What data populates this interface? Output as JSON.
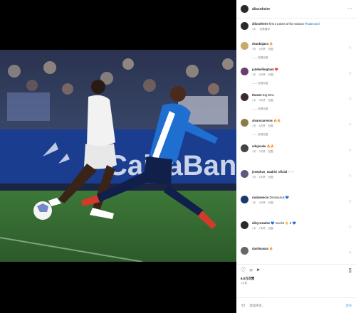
{
  "post": {
    "author": "dilsonfreire",
    "caption": "first 3 points of the season",
    "hashtag": "#hala­ma­rid",
    "caption_time": "1天",
    "caption_translate": "查看翻译"
  },
  "photo": {
    "banner_text": "CaixaBank",
    "dots": "• • •"
  },
  "comments": [
    {
      "user": "dsanbajaco",
      "text": "🔥",
      "time": "1天",
      "likes": "4次赞",
      "reply": "回复",
      "replies": "—— 查看回复",
      "color": "#c9a86b"
    },
    {
      "user": "judebellingham",
      "text": "❤️",
      "time": "1天",
      "likes": "6次赞",
      "reply": "回复",
      "replies": "—— 查看回复",
      "color": "#6a3d6e"
    },
    {
      "user": "thusen",
      "text": "Big Dino",
      "time": "1天",
      "likes": "3次赞",
      "reply": "回复",
      "replies": "—— 查看回复",
      "color": "#3d2a2a"
    },
    {
      "user": "alvarocarreras",
      "text": "🔥🔥",
      "time": "1天",
      "likes": "5次赞",
      "reply": "回复",
      "replies": "—— 查看回复",
      "color": "#8b7d4a"
    },
    {
      "user": "edujosele",
      "text": "🔥🔥",
      "time": "1天",
      "likes": "2次赞",
      "reply": "回复",
      "replies": "",
      "color": "#444"
    },
    {
      "user": "josephus_madrid_oficial",
      "text": "♡ ♡",
      "time": "1天",
      "likes": "1次赞",
      "reply": "回复",
      "replies": "",
      "color": "#5a5a7a"
    },
    {
      "user": "raulasencio",
      "text": "Dinosaurus 💙",
      "time": "1天",
      "likes": "4次赞",
      "reply": "回复",
      "replies": "",
      "color": "#1a3a6a"
    },
    {
      "user": "alleyrozadee",
      "text": "💙 mucho 👋 ♥ 💙",
      "time": "1天",
      "likes": "2次赞",
      "reply": "回复",
      "replies": "",
      "color": "#2a2a2a"
    },
    {
      "user": "danlimasan",
      "text": "🔥",
      "time": "",
      "likes": "",
      "reply": "",
      "replies": "",
      "color": "#666"
    }
  ],
  "actions": {
    "like": "♡",
    "comment": "○",
    "share": "➤",
    "bookmark": "▯"
  },
  "likes_text": "8.5万次赞",
  "posted_text": "1天前",
  "comment_input": {
    "placeholder": "添加评论...",
    "post_label": "发布",
    "emoji": "☺"
  },
  "colors": {
    "link": "#1d6fb8",
    "post_btn": "#8cc3f5"
  }
}
